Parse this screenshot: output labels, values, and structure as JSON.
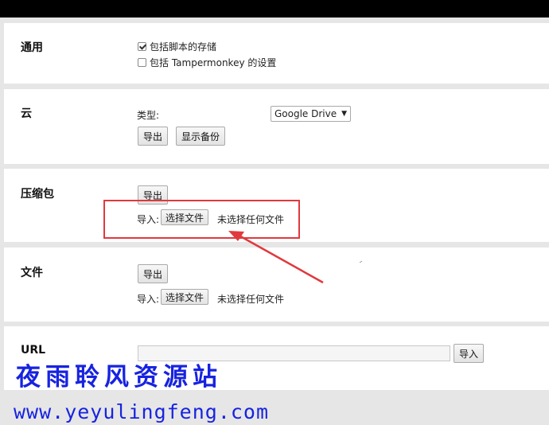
{
  "general": {
    "title": "通用",
    "options": [
      {
        "label": "包括脚本的存储",
        "checked": true
      },
      {
        "label": "包括 Tampermonkey 的设置",
        "checked": false
      }
    ]
  },
  "cloud": {
    "title": "云",
    "type_label": "类型:",
    "type_value": "Google Drive",
    "export_label": "导出",
    "show_backup_label": "显示备份"
  },
  "zip": {
    "title": "压缩包",
    "export_label": "导出",
    "import_label": "导入:",
    "choose_file_label": "选择文件",
    "no_file_label": "未选择任何文件"
  },
  "file": {
    "title": "文件",
    "export_label": "导出",
    "import_label": "导入:",
    "choose_file_label": "选择文件",
    "no_file_label": "未选择任何文件"
  },
  "url": {
    "title": "URL",
    "input_value": "",
    "import_label": "导入"
  },
  "watermark": {
    "line1": "夜雨聆风资源站",
    "line2": "www.yeyulingfeng.com"
  },
  "colors": {
    "annotation": "#e0393e",
    "watermark": "#1723e0"
  }
}
